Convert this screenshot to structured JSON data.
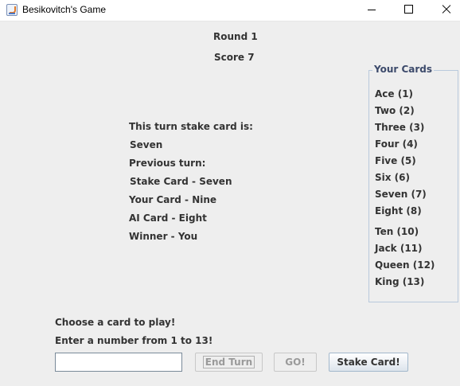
{
  "window": {
    "title": "Besikovitch's Game",
    "controls": [
      "minimize-icon",
      "maximize-icon",
      "close-icon"
    ]
  },
  "header": {
    "round": "Round 1",
    "score": "Score 7"
  },
  "status": {
    "stake_heading": "This turn stake card is:",
    "stake_card": "Seven",
    "previous_heading": "Previous turn:",
    "previous_stake": "Stake Card - Seven",
    "your_card": "Your Card - Nine",
    "ai_card": "AI Card - Eight",
    "winner": "Winner - You"
  },
  "cards": {
    "title": "Your Cards",
    "items": [
      "Ace (1)",
      "Two (2)",
      "Three (3)",
      "Four (4)",
      "Five (5)",
      "Six (6)",
      "Seven (7)",
      "Eight (8)",
      "Ten (10)",
      "Jack (11)",
      "Queen (12)",
      "King (13)"
    ]
  },
  "prompt": {
    "line1": "Choose a card to play!",
    "line2": "Enter a number from 1 to 13!"
  },
  "input": {
    "value": ""
  },
  "buttons": {
    "end_turn": "End Turn",
    "go": "GO!",
    "stake": "Stake Card!"
  }
}
